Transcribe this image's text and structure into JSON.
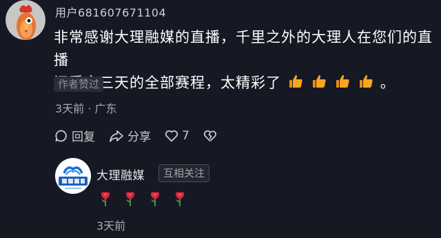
{
  "comment": {
    "username": "用户681607671104",
    "text_line1": "非常感谢大理融媒的直播，千里之外的大理人在您们的直播",
    "text_line2": "间看完三天的全部赛程，太精彩了",
    "text_end": "。",
    "emoji": "thumbs-up",
    "author_liked": "作者赞过",
    "time_location": "3天前 · 广东",
    "actions": {
      "reply": "回复",
      "share": "分享",
      "like_count": "7"
    }
  },
  "reply": {
    "name": "大理融媒",
    "relation": "互相关注",
    "emoji": "rose",
    "time": "3天前",
    "logo_text": "大理融媒"
  },
  "colors": {
    "background": "#161823",
    "text_primary": "#ffffff",
    "text_secondary": "#a9aab2",
    "emoji_thumb": "#f6a623",
    "emoji_rose": "#d9233a"
  }
}
